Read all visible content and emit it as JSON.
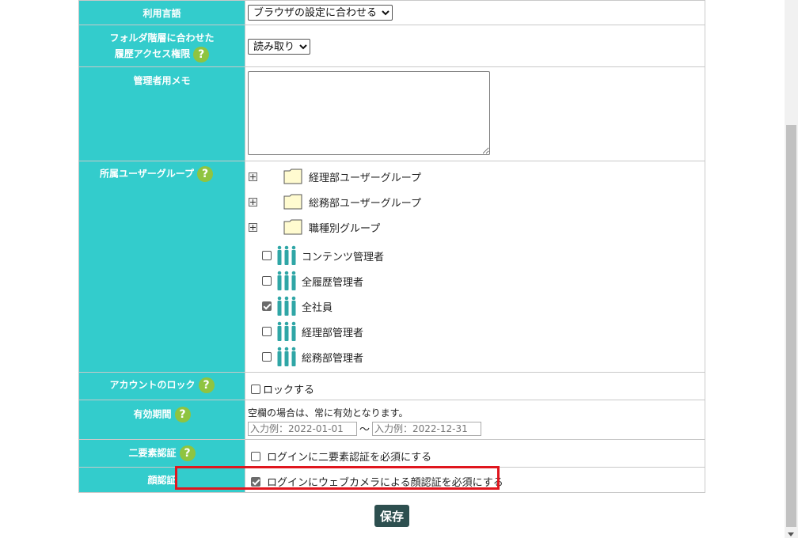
{
  "help_icon_glyph": "?",
  "rows": {
    "language": {
      "label": "利用言語",
      "selected": "ブラウザの設定に合わせる"
    },
    "folder_access": {
      "label_line1": "フォルダ階層に合わせた",
      "label_line2": "履歴アクセス権限",
      "selected": "読み取り"
    },
    "admin_memo": {
      "label": "管理者用メモ",
      "value": ""
    },
    "user_groups": {
      "label": "所属ユーザーグループ",
      "folders": [
        "経理部ユーザーグループ",
        "総務部ユーザーグループ",
        "職種別グループ"
      ],
      "groups": [
        {
          "name": "コンテンツ管理者",
          "checked": false
        },
        {
          "name": "全履歴管理者",
          "checked": false
        },
        {
          "name": "全社員",
          "checked": true
        },
        {
          "name": "経理部管理者",
          "checked": false
        },
        {
          "name": "総務部管理者",
          "checked": false
        }
      ]
    },
    "account_lock": {
      "label": "アカウントのロック",
      "checkbox_label": "ロックする"
    },
    "validity": {
      "label": "有効期間",
      "note": "空欄の場合は、常に有効となります。",
      "start_placeholder": "入力例：2022-01-01",
      "separator": "～",
      "end_placeholder": "入力例：2022-12-31"
    },
    "two_factor": {
      "label": "二要素認証",
      "checkbox_label": "ログインに二要素認証を必須にする"
    },
    "face_auth": {
      "label": "顔認証",
      "checkbox_label": "ログインにウェブカメラによる顔認証を必須にする"
    }
  },
  "save_label": "保存",
  "colors": {
    "label_bg": "#33cccc",
    "help_icon": "#8fc440",
    "save_button": "#2d4f4f",
    "highlight": "#e0161e",
    "people_icon": "#2fa6a6"
  }
}
